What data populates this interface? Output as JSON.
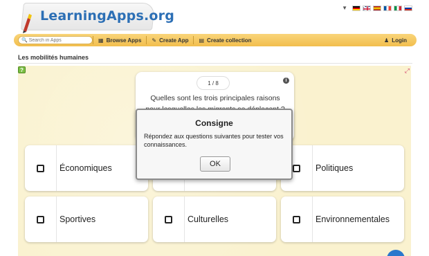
{
  "header": {
    "logo_text": "LearningApps.org",
    "languages": [
      {
        "name": "German",
        "colors": [
          "#000000",
          "#dd0000",
          "#ffce00"
        ]
      },
      {
        "name": "English",
        "colors": [
          "#012169",
          "#ffffff",
          "#c8102e"
        ]
      },
      {
        "name": "Spanish",
        "colors": [
          "#aa151b",
          "#f1bf00",
          "#aa151b"
        ]
      },
      {
        "name": "French",
        "colors": [
          "#0055a4",
          "#ffffff",
          "#ef4135"
        ]
      },
      {
        "name": "Italian",
        "colors": [
          "#009246",
          "#ffffff",
          "#ce2b37"
        ]
      },
      {
        "name": "Russian",
        "colors": [
          "#ffffff",
          "#0039a6",
          "#d52b1e"
        ]
      }
    ]
  },
  "toolbar": {
    "search_placeholder": "Search in Apps",
    "browse_label": "Browse Apps",
    "create_label": "Create App",
    "collection_label": "Create collection",
    "login_label": "Login"
  },
  "app": {
    "title": "Les mobilités humaines",
    "counter": "1 / 8",
    "question": "Quelles sont les trois principales raisons pour lesquelles les migrants se déplacent ?",
    "answers": [
      {
        "label": "Économiques"
      },
      {
        "label": ""
      },
      {
        "label": "Politiques"
      },
      {
        "label": "Sportives"
      },
      {
        "label": "Culturelles"
      },
      {
        "label": "Environnementales"
      }
    ]
  },
  "modal": {
    "title": "Consigne",
    "body": "Répondez aux questions suivantes pour tester vos connaissances.",
    "ok_label": "OK"
  },
  "colors": {
    "toolbar": "#f2be4d",
    "app_background": "#faf2cf",
    "logo": "#2c6fb5"
  }
}
